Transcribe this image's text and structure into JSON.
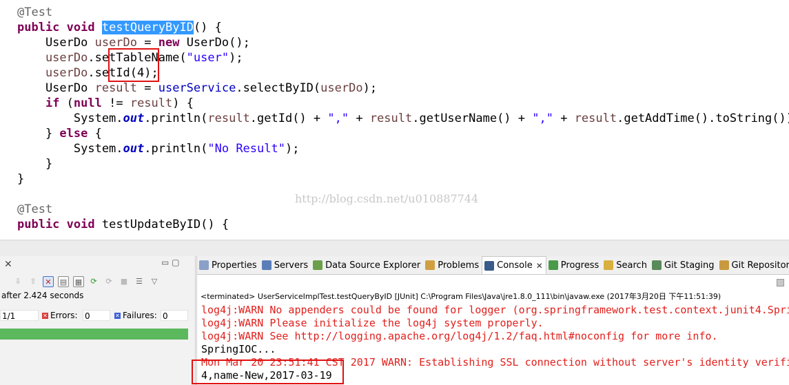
{
  "editor": {
    "lines": [
      {
        "id": "l1",
        "tokens": [
          {
            "c": "ann",
            "t": "@Test"
          }
        ]
      },
      {
        "id": "l2",
        "tokens": [
          {
            "c": "kw",
            "t": "public"
          },
          {
            "c": "",
            "t": " "
          },
          {
            "c": "kw",
            "t": "void"
          },
          {
            "c": "",
            "t": " "
          },
          {
            "c": "hl",
            "t": "testQueryByID"
          },
          {
            "c": "",
            "t": "() {"
          }
        ]
      },
      {
        "id": "l3",
        "tokens": [
          {
            "c": "",
            "t": "    UserDo "
          },
          {
            "c": "var",
            "t": "userDo"
          },
          {
            "c": "",
            "t": " = "
          },
          {
            "c": "kw",
            "t": "new"
          },
          {
            "c": "",
            "t": " UserDo();"
          }
        ]
      },
      {
        "id": "l4",
        "tokens": [
          {
            "c": "var",
            "t": "    userDo"
          },
          {
            "c": "",
            "t": ".setTableName("
          },
          {
            "c": "str",
            "t": "\"user\""
          },
          {
            "c": "",
            "t": ");"
          }
        ]
      },
      {
        "id": "l5",
        "tokens": [
          {
            "c": "var",
            "t": "    userDo"
          },
          {
            "c": "",
            "t": ".setId(4);"
          }
        ]
      },
      {
        "id": "l6",
        "tokens": [
          {
            "c": "",
            "t": "    UserDo "
          },
          {
            "c": "var",
            "t": "result"
          },
          {
            "c": "",
            "t": " = "
          },
          {
            "c": "fld",
            "t": "userService"
          },
          {
            "c": "",
            "t": ".selectByID("
          },
          {
            "c": "var",
            "t": "userDo"
          },
          {
            "c": "",
            "t": ");"
          }
        ]
      },
      {
        "id": "l7",
        "tokens": [
          {
            "c": "",
            "t": "    "
          },
          {
            "c": "kw",
            "t": "if"
          },
          {
            "c": "",
            "t": " ("
          },
          {
            "c": "kw",
            "t": "null"
          },
          {
            "c": "",
            "t": " != "
          },
          {
            "c": "var",
            "t": "result"
          },
          {
            "c": "",
            "t": ") {"
          }
        ]
      },
      {
        "id": "l8",
        "tokens": [
          {
            "c": "",
            "t": "        System."
          },
          {
            "c": "sfld",
            "t": "out"
          },
          {
            "c": "",
            "t": ".println("
          },
          {
            "c": "var",
            "t": "result"
          },
          {
            "c": "",
            "t": ".getId() + "
          },
          {
            "c": "str",
            "t": "\",\""
          },
          {
            "c": "",
            "t": " + "
          },
          {
            "c": "var",
            "t": "result"
          },
          {
            "c": "",
            "t": ".getUserName() + "
          },
          {
            "c": "str",
            "t": "\",\""
          },
          {
            "c": "",
            "t": " + "
          },
          {
            "c": "var",
            "t": "result"
          },
          {
            "c": "",
            "t": ".getAddTime().toString());"
          }
        ]
      },
      {
        "id": "l9",
        "tokens": [
          {
            "c": "",
            "t": "    } "
          },
          {
            "c": "kw",
            "t": "else"
          },
          {
            "c": "",
            "t": " {"
          }
        ]
      },
      {
        "id": "l10",
        "tokens": [
          {
            "c": "",
            "t": "        System."
          },
          {
            "c": "sfld",
            "t": "out"
          },
          {
            "c": "",
            "t": ".println("
          },
          {
            "c": "str",
            "t": "\"No Result\""
          },
          {
            "c": "",
            "t": ");"
          }
        ]
      },
      {
        "id": "l11",
        "tokens": [
          {
            "c": "",
            "t": "    }"
          }
        ]
      },
      {
        "id": "l12",
        "tokens": [
          {
            "c": "",
            "t": "}"
          }
        ]
      },
      {
        "id": "l13",
        "tokens": []
      },
      {
        "id": "l14",
        "tokens": [
          {
            "c": "ann",
            "t": "@Test"
          }
        ]
      },
      {
        "id": "l15",
        "tokens": [
          {
            "c": "kw",
            "t": "public"
          },
          {
            "c": "",
            "t": " "
          },
          {
            "c": "kw",
            "t": "void"
          },
          {
            "c": "",
            "t": " testUpdateByID() {"
          }
        ]
      }
    ],
    "watermark": "http://blog.csdn.net/u010887744"
  },
  "junit": {
    "close_glyph": "✕",
    "minmax_glyph": "▭ ▢",
    "elapsed": "after 2.424 seconds",
    "runs_value": "1/1",
    "errors_label": "Errors:",
    "errors_value": "0",
    "failures_label": "Failures:",
    "failures_value": "0",
    "progress_fraction": 1.0,
    "progress_color": "#5cb85c"
  },
  "tabs": [
    {
      "label": "Properties",
      "icon": "properties-icon",
      "color": "#8aa0c8"
    },
    {
      "label": "Servers",
      "icon": "servers-icon",
      "color": "#5a7fb8"
    },
    {
      "label": "Data Source Explorer",
      "icon": "database-icon",
      "color": "#6aa04a"
    },
    {
      "label": "Problems",
      "icon": "problems-icon",
      "color": "#d0a040"
    },
    {
      "label": "Console",
      "icon": "console-icon",
      "color": "#3a5a8a",
      "active": true,
      "close": "✕"
    },
    {
      "label": "Progress",
      "icon": "progress-icon",
      "color": "#4a9a4a"
    },
    {
      "label": "Search",
      "icon": "search-icon",
      "color": "#d8b040"
    },
    {
      "label": "Git Staging",
      "icon": "git-staging-icon",
      "color": "#5a8a5a"
    },
    {
      "label": "Git Repositories",
      "icon": "git-repositories-icon",
      "color": "#c89a40"
    }
  ],
  "console": {
    "terminated": "<terminated> UserServiceImplTest.testQueryByID [JUnit] C:\\Program Files\\Java\\jre1.8.0_111\\bin\\javaw.exe (2017年3月20日 下午11:51:39)",
    "lines": [
      {
        "t": "log4j:WARN No appenders could be found for logger (org.springframework.test.context.junit4.Spri",
        "c": "red"
      },
      {
        "t": "log4j:WARN Please initialize the log4j system properly.",
        "c": "red"
      },
      {
        "t": "log4j:WARN See http://logging.apache.org/log4j/1.2/faq.html#noconfig for more info.",
        "c": "red"
      },
      {
        "t": "SpringIOC...",
        "c": "blk"
      },
      {
        "t": "Mon Mar 20 23:51:41 CST 2017 WARN: Establishing SSL connection without server's identity verifi",
        "c": "red"
      },
      {
        "t": "4,name-New,2017-03-19",
        "c": "blk"
      }
    ]
  },
  "colors": {
    "highlight": "#3399ff",
    "annotation_box": "#e01010",
    "error_text": "#e0201c"
  }
}
